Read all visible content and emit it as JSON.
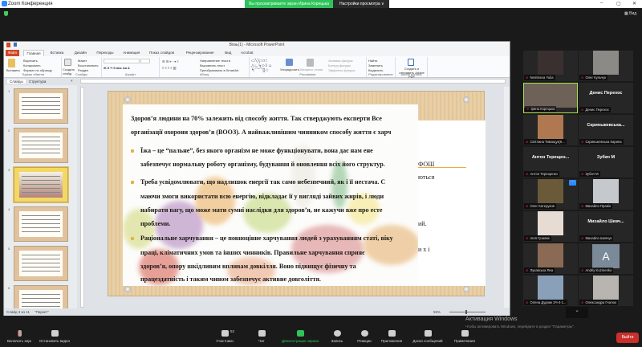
{
  "zoom": {
    "window_title": "Zoom Конференция",
    "banner": "Вы просматриваете экран Ирина Корецька",
    "view_options": "Настройки просмотра ∨",
    "view_button": "Вид",
    "activation_title": "Активация Windows",
    "activation_text": "Чтобы активировать Windows, перейдите в раздел \"Параметры\".",
    "toolbar": {
      "mute": "Включить звук",
      "video": "Остановить видео",
      "participants": "Участники",
      "participants_count": "52",
      "chat": "Чат",
      "share": "Демонстрация экрана",
      "record": "Запись",
      "reactions": "Реакции",
      "apps": "Приложения",
      "whiteboards": "Доски сообщений",
      "notes": "Примечания",
      "leave": "Выйти"
    },
    "accent": "#2fc35b"
  },
  "participants": [
    {
      "name": "Nemtseva Yulia",
      "video": "#3a3030"
    },
    {
      "name": "Олег Кульчук",
      "video": "#8c8a86"
    },
    {
      "name": "Ірина Корецька",
      "video": "#6e6258",
      "active": true
    },
    {
      "name": "Денис Перехос",
      "big": "Денис Перехос"
    },
    {
      "name": "Світлана Тимощук(К...",
      "video": "#b07850"
    },
    {
      "name": "Скриньжевська Карина",
      "big": "Скриньжевська..."
    },
    {
      "name": "Антон Терещенко",
      "big": "Антон Терещен..."
    },
    {
      "name": "Зубач М",
      "big": "Зубач М"
    },
    {
      "name": "Олег Катеруков",
      "video": "#6a5a3a"
    },
    {
      "name": "Михайло Правін",
      "video": "#c5c8cc"
    },
    {
      "name": "Ілля Гузавик",
      "video": "#e6dcd4"
    },
    {
      "name": "Михайло Шевчук",
      "big": "Михайло Шевч..."
    },
    {
      "name": "Лукавська Яна",
      "video": "#8a6a55"
    },
    {
      "name": "Andriy Kuzmenko",
      "avatar": "A"
    },
    {
      "name": "Олена Дудник ЗЧ-4-1...",
      "video": "#8aa0b8"
    },
    {
      "name": "Олександра Гнатюк",
      "video": "#b8b4b0"
    }
  ],
  "powerpoint": {
    "title": "Вязь(1) - Microsoft PowerPoint",
    "tabs": [
      "Файл",
      "Главная",
      "Вставка",
      "Дизайн",
      "Переходы",
      "Анимация",
      "Показ слайдов",
      "Рецензирование",
      "Вид",
      "Acrobat"
    ],
    "active_tab": "Главная",
    "ribbon": {
      "paste": "Вставить",
      "cut": "Вырезать",
      "copy": "Копировать",
      "format_painter": "Формат по образцу",
      "clipboard": "Буфер обмена",
      "new_slide": "Создать слайд",
      "layout": "Макет",
      "reset": "Восстановить",
      "section": "Раздел",
      "slides": "Слайды",
      "font": "Шрифт",
      "text_direction": "Направление текста",
      "align_text": "Выровнять текст",
      "smartart": "Преобразовать в SmartArt",
      "paragraph": "Абзац",
      "arrange": "Упорядочить",
      "quick_styles": "Экспресс-стили",
      "shape_fill": "Заливка фигуры",
      "shape_outline": "Контур фигуры",
      "shape_effects": "Эффекты фигуры",
      "drawing": "Рисование",
      "find": "Найти",
      "replace": "Заменить",
      "select": "Выделить",
      "editing": "Редактирование",
      "create_pdf": "Создать и отправить Adobe PDF",
      "adobe": "Adobe Acrobat"
    },
    "pane_tabs": [
      "Слайды",
      "Структура"
    ],
    "status": {
      "slide": "Слайд 3 из 11",
      "theme": "\"Паркет\"",
      "zoom": "55%"
    },
    "slide": {
      "lines": [
        "Здоров’я людини на 70% залежить від способу життя. Так стверджують експерти Все",
        "організації охорони здоров’я (ВООЗ). А найважливішим чинником способу життя є харч",
        "Їжа – це “пальне”, без якого організм не може функціонувати, вона дає нам ене",
        "забезпечує нормальну роботу організму, будування й оновлення всіх його структур.",
        "Треба усвідомлювати, що надлишок енергії так само небезпечний, як і її нестача. С",
        "маючи змоги використати всю енергію, відкладає її у вигляді зайвих жирів, і люди",
        "набирати вагу, що може мати сумні наслідки для здоров’я, не кажучи вже про есте",
        "проблеми.",
        "Раціональне харчування – це повноцінне харчування людей з урахуванням статі, віку",
        "праці, кліматичних умов та інших чинників. Правильне харчування сприяє",
        "здоров’я, опору шкідливим впливам довкілля. Воно підвищує фізичну та",
        "працездатність і таким чином забезпечує активне довголіття."
      ],
      "fragments": [
        "ФОШ",
        "ються",
        "ий.",
        "и х і"
      ]
    }
  }
}
